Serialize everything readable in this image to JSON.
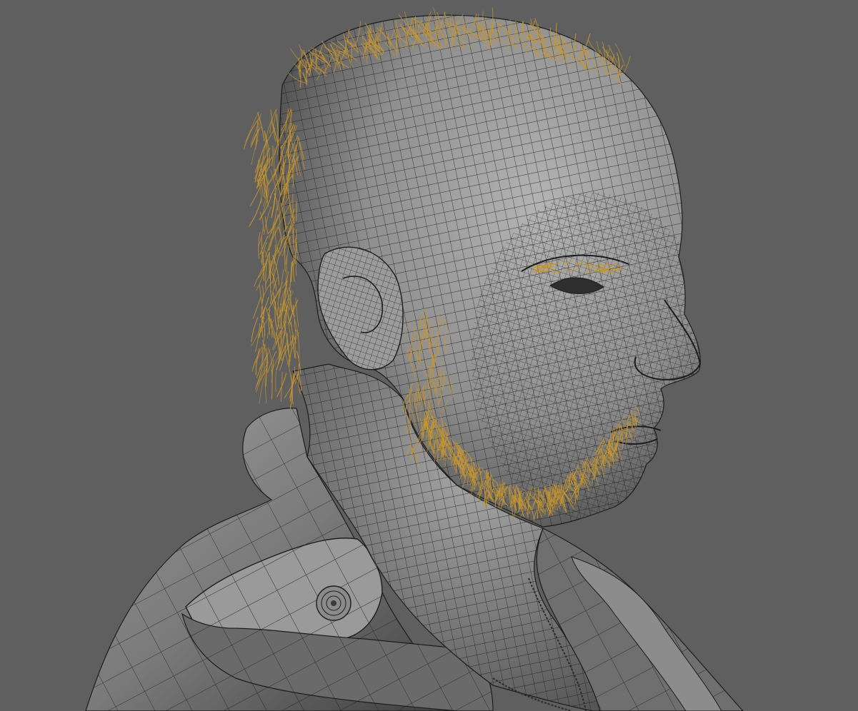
{
  "viewport": {
    "background": "#5f5f5f",
    "subject": "wireframe-head-bust",
    "colors": {
      "mesh_fill": "#8a8a8a",
      "mesh_shadow": "#3a3a3a",
      "wire": "#1c1c1c",
      "hair": "#c8962e"
    }
  }
}
